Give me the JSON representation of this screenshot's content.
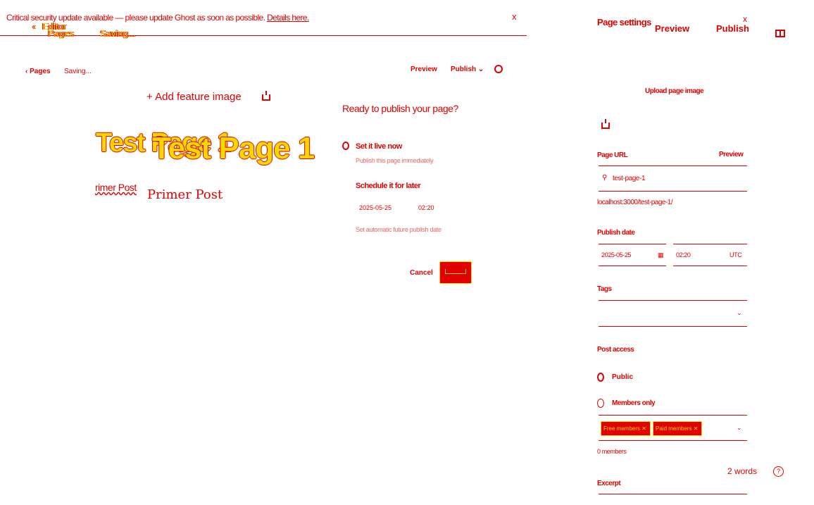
{
  "banner": {
    "message": "Critical security update available — please update Ghost as soon as possible.",
    "link": "Details here.",
    "close": "x"
  },
  "ghost_header": {
    "editor": "Editor",
    "pages": "Pages",
    "saving": "Saving..."
  },
  "toolbar": {
    "back": "‹ Pages",
    "saving": "Saving...",
    "preview": "Preview",
    "publish": "Publish ⌄"
  },
  "editor": {
    "add_feature_image": "+ Add feature image",
    "title": "Test Page 1",
    "title_ghost": "Test Page 1",
    "excerpt": "rimer Post",
    "excerpt_ghost": "Primer Post",
    "word_count": "2 words"
  },
  "publish_popover": {
    "title": "Ready to publish your page?",
    "option_now": "Set it live now",
    "option_now_sub": "Publish this page immediately",
    "option_later": "Schedule it for later",
    "date": "2025-05-25",
    "time": "02:20",
    "option_later_sub": "Set automatic future publish date",
    "cancel": "Cancel"
  },
  "settings": {
    "title": "Page settings",
    "preview": "Preview",
    "publish": "Publish",
    "close": "x",
    "upload_image": "Upload page image",
    "url_label": "Page URL",
    "url_preview": "Preview",
    "url_slug": "test-page-1",
    "url_full": "localhost:3000/test-page-1/",
    "date_label": "Publish date",
    "date": "2025-05-25",
    "time": "02:20",
    "timezone": "UTC",
    "tags_label": "Tags",
    "access_label": "Post access",
    "public": "Public",
    "members_only": "Members only",
    "tier_chips": [
      "Free members",
      "Paid members"
    ],
    "members_count": "0 members",
    "word_count": "2 words",
    "excerpt_label": "Excerpt"
  },
  "colors": {
    "primary": "#e00000",
    "secondary": "#f4d800",
    "background": "#ffffff"
  }
}
